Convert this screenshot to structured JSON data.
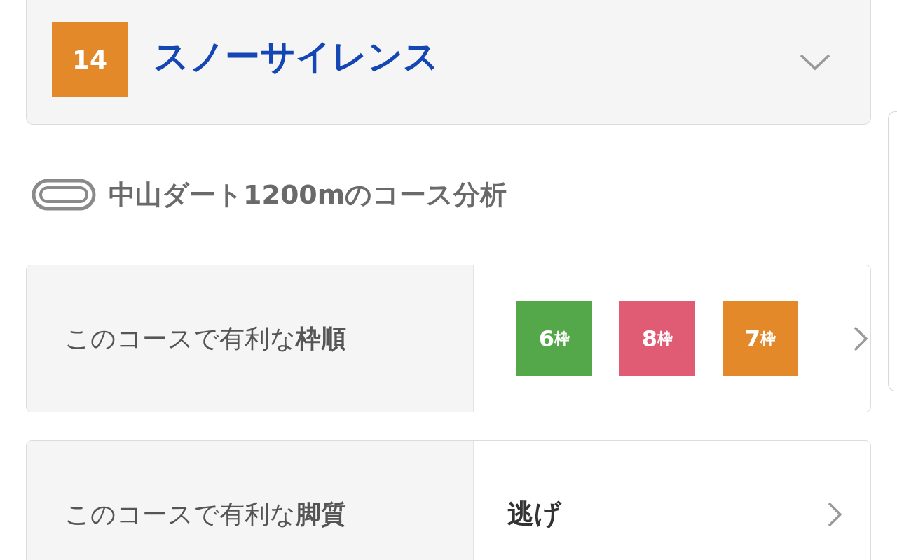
{
  "horse": {
    "number": "14",
    "color": "#e3892a",
    "name": "スノーサイレンス",
    "expanded": false
  },
  "course_heading": "中山ダート1200mのコース分析",
  "rows": [
    {
      "kind": "badges",
      "label": "このコースで有利な**枠順**",
      "badges": [
        {
          "number": "6",
          "unit": "枠",
          "color": "#55a84a"
        },
        {
          "number": "8",
          "unit": "枠",
          "color": "#e05c75"
        },
        {
          "number": "7",
          "unit": "枠",
          "color": "#e3892a"
        }
      ]
    },
    {
      "kind": "text",
      "label": "このコースで有利な**脚質**",
      "value": "逃げ"
    }
  ]
}
